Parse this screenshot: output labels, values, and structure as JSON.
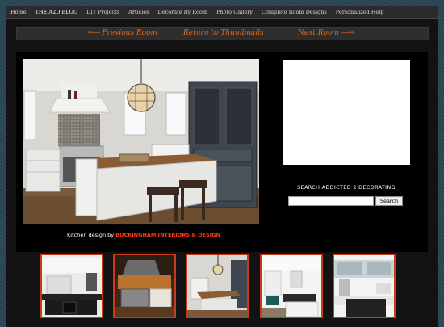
{
  "nav": {
    "items": [
      "Home",
      "THE A2D BLOG",
      "DIY Projects",
      "Articles",
      "Decorate By Room",
      "Photo Gallery",
      "Complete Room Designs",
      "Personalized Help"
    ]
  },
  "pager": {
    "prev": "Previous Room",
    "back": "Return to Thumbnails",
    "next": "Next Room"
  },
  "caption": {
    "prefix": "Kitchen design by ",
    "link": "BUCKINGHAM INTERIORS & DESIGN"
  },
  "search": {
    "title": "SEARCH ADDICTED 2 DECORATING",
    "input_value": "",
    "button": "Search"
  },
  "colors": {
    "accent": "#e3661e",
    "thumb_border": "#c83a1c",
    "caption_link": "#ff3a1a"
  }
}
